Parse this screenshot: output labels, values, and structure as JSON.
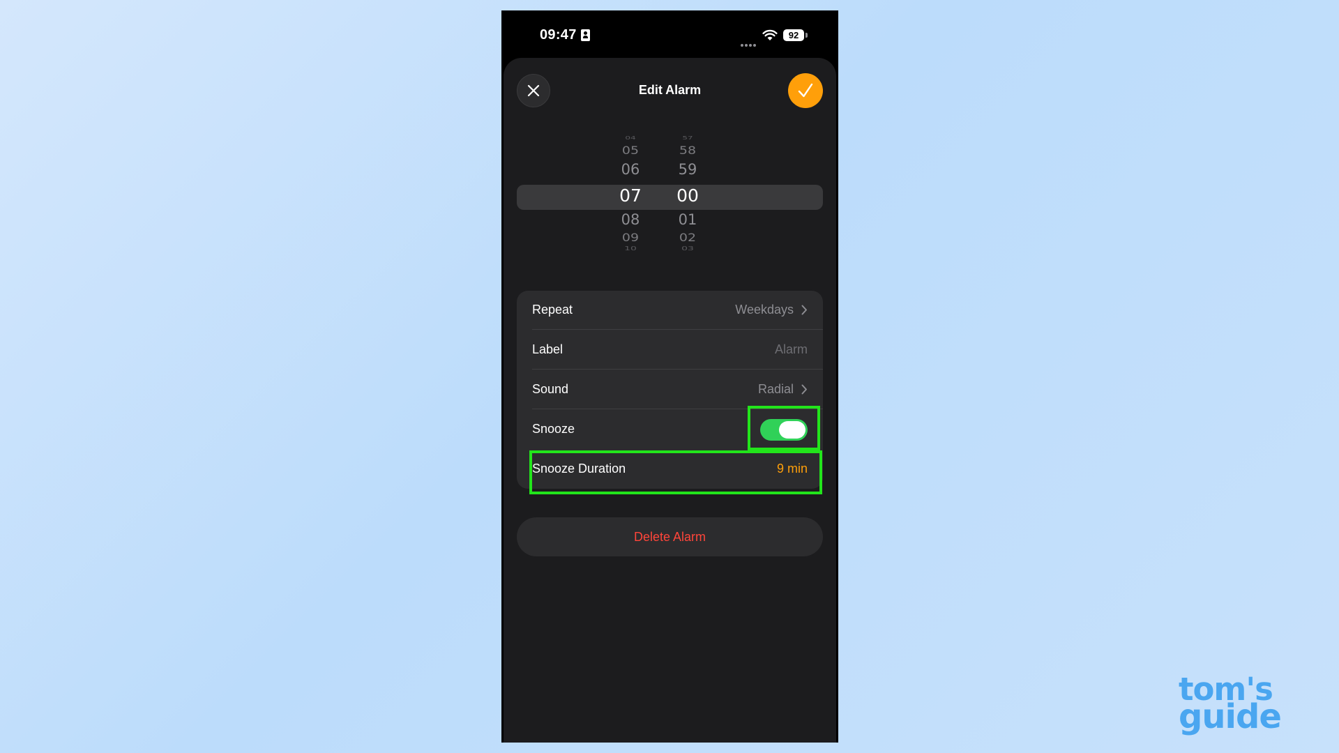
{
  "status_bar": {
    "time": "09:47",
    "battery": "92"
  },
  "sheet": {
    "title": "Edit Alarm"
  },
  "picker": {
    "hours": [
      "04",
      "05",
      "06",
      "07",
      "08",
      "09",
      "10"
    ],
    "minutes": [
      "57",
      "58",
      "59",
      "00",
      "01",
      "02",
      "03"
    ]
  },
  "settings": {
    "repeat": {
      "label": "Repeat",
      "value": "Weekdays"
    },
    "label": {
      "label": "Label",
      "placeholder": "Alarm"
    },
    "sound": {
      "label": "Sound",
      "value": "Radial"
    },
    "snooze": {
      "label": "Snooze",
      "enabled": true
    },
    "snooze_duration": {
      "label": "Snooze Duration",
      "value": "9 min"
    }
  },
  "delete_label": "Delete Alarm",
  "watermark": {
    "line1": "tom's",
    "line2": "guide"
  },
  "colors": {
    "accent": "#ff9f0a",
    "toggle_on": "#30d158",
    "destructive": "#ff453a",
    "highlight": "#22e51b"
  }
}
